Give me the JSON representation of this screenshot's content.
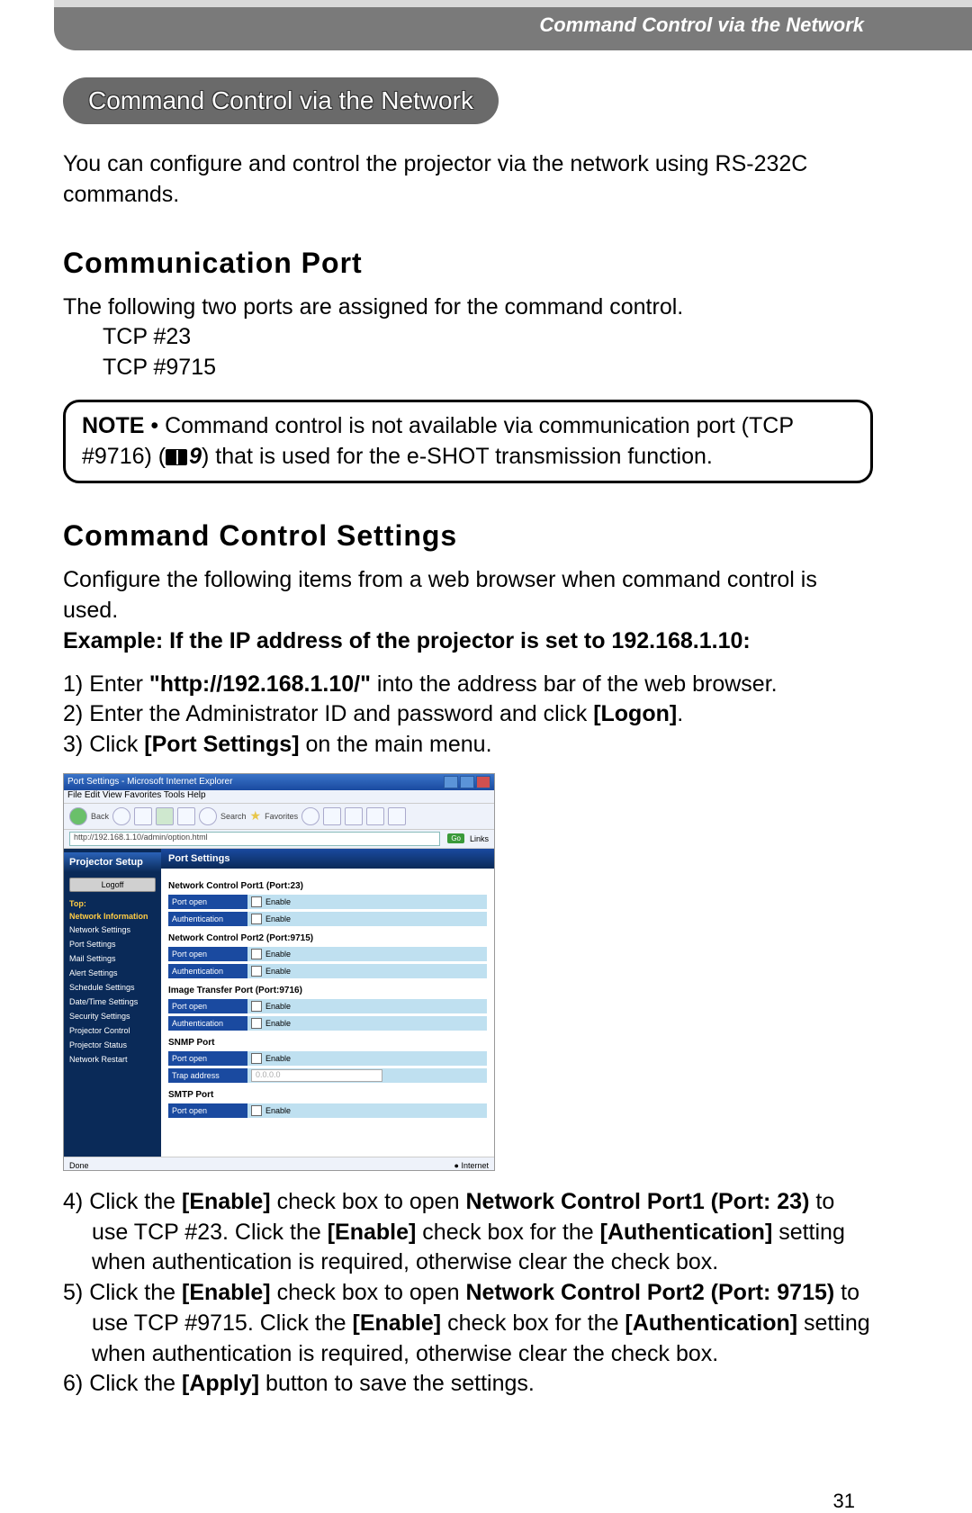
{
  "header": {
    "title": "Command Control via the Network"
  },
  "sections": {
    "pill_title": "Command Control via the Network",
    "intro": "You can configure and control the projector via the network using RS-232C commands.",
    "comm_port": {
      "heading": "Communication Port",
      "desc": "The following two ports are assigned for the command control.",
      "ports": [
        "TCP #23",
        "TCP #9715"
      ]
    },
    "note": {
      "label": "NOTE",
      "text_before": " • Command control is not available via communication port (TCP #9716) (",
      "page_ref": "9",
      "text_after": ") that is used for the e-SHOT transmission function."
    },
    "cc_settings": {
      "heading": "Command Control Settings",
      "desc": "Configure the following items from a web browser when command control is used.",
      "example_label": "Example: If the IP address of the projector is set to 192.168.1.10:",
      "steps_top": [
        {
          "n": "1)",
          "pre": "Enter ",
          "bold": "\"http://192.168.1.10/\"",
          "post": " into the address bar of the web browser."
        },
        {
          "n": "2)",
          "pre": "Enter the Administrator ID and password and click ",
          "bold": "[Logon]",
          "post": "."
        },
        {
          "n": "3)",
          "pre": "Click ",
          "bold": "[Port Settings]",
          "post": " on the main menu."
        }
      ],
      "steps_bottom": [
        {
          "n": "4)",
          "text": "Click the [Enable] check box to open Network Control Port1 (Port: 23) to use TCP #23. Click the [Enable] check box for the [Authentication] setting when authentication is required, otherwise clear the check box.",
          "bolds": [
            "[Enable]",
            "Network Control Port1 (Port: 23)",
            "[Enable]",
            "[Authentication]"
          ]
        },
        {
          "n": "5)",
          "text": "Click the [Enable] check box to open Network Control Port2 (Port: 9715) to use TCP #9715. Click the [Enable] check box for the [Authentication] setting when authentication is required, otherwise clear the check box.",
          "bolds": [
            "[Enable]",
            "Network Control Port2 (Port: 9715)",
            "[Enable]",
            "[Authentication]"
          ]
        },
        {
          "n": "6)",
          "text": "Click the [Apply] button to save the settings.",
          "bolds": [
            "[Apply]"
          ]
        }
      ]
    }
  },
  "screenshot": {
    "window_title": "Port Settings - Microsoft Internet Explorer",
    "menubar": "File  Edit  View  Favorites  Tools  Help",
    "toolbar_back": "Back",
    "toolbar_search": "Search",
    "toolbar_fav": "Favorites",
    "address": "http://192.168.1.10/admin/option.html",
    "go": "Go",
    "links": "Links",
    "sidebar": {
      "brand": "Projector Setup",
      "logoff": "Logoff",
      "top": "Top:",
      "network_info": "Network Information",
      "items": [
        "Network Settings",
        "Port Settings",
        "Mail Settings",
        "Alert Settings",
        "Schedule Settings",
        "Date/Time Settings",
        "Security Settings",
        "Projector Control",
        "Projector Status",
        "Network Restart"
      ]
    },
    "main": {
      "title": "Port Settings",
      "groups": [
        {
          "title": "Network Control Port1 (Port:23)",
          "rows": [
            {
              "label": "Port open",
              "val": "Enable",
              "chk": true
            },
            {
              "label": "Authentication",
              "val": "Enable",
              "chk": true
            }
          ]
        },
        {
          "title": "Network Control Port2 (Port:9715)",
          "rows": [
            {
              "label": "Port open",
              "val": "Enable",
              "chk": true
            },
            {
              "label": "Authentication",
              "val": "Enable",
              "chk": true
            }
          ]
        },
        {
          "title": "Image Transfer Port (Port:9716)",
          "rows": [
            {
              "label": "Port open",
              "val": "Enable",
              "chk": true
            },
            {
              "label": "Authentication",
              "val": "Enable",
              "chk": true
            }
          ]
        },
        {
          "title": "SNMP Port",
          "rows": [
            {
              "label": "Port open",
              "val": "Enable",
              "chk": true
            },
            {
              "label": "Trap address",
              "input": "0.0.0.0"
            }
          ]
        },
        {
          "title": "SMTP Port",
          "rows": [
            {
              "label": "Port open",
              "val": "Enable",
              "chk": true
            }
          ]
        }
      ]
    },
    "status_left": "Done",
    "status_right": "Internet"
  },
  "page_number": "31"
}
